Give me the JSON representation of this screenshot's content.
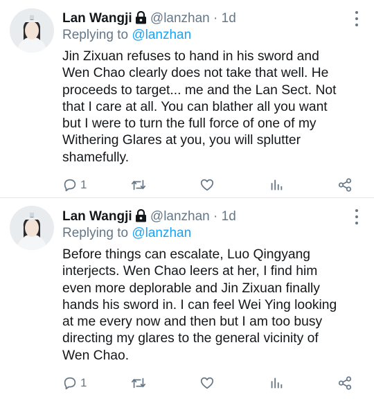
{
  "tweets": [
    {
      "user": {
        "name": "Lan Wangji",
        "handle": "@lanzhan"
      },
      "separator": "·",
      "time": "1d",
      "replying_prefix": "Replying to",
      "replying_to": "@lanzhan",
      "text_lines": [
        "Jin Zixuan refuses to hand in his sword and",
        "Wen Chao clearly does not take that well. He",
        "proceeds to target... me and the Lan Sect. Not",
        "that I care at all. You can blather all you want",
        "but I were to turn the full force of one of my",
        "Withering Glares at you, you will splutter",
        "shamefully."
      ],
      "reply_count": "1"
    },
    {
      "user": {
        "name": "Lan Wangji",
        "handle": "@lanzhan"
      },
      "separator": "·",
      "time": "1d",
      "replying_prefix": "Replying to",
      "replying_to": "@lanzhan",
      "text_lines": [
        "Before things can escalate, Luo Qingyang",
        "interjects. Wen Chao leers at her, I find him",
        "even more deplorable and Jin Zixuan finally",
        "hands his sword in. I can feel Wei Ying looking",
        "at me every now and then but I am too busy",
        "directing my glares to the general vicinity of",
        "Wen Chao."
      ],
      "reply_count": "1"
    }
  ],
  "icons": {
    "lock": "lock-icon",
    "more": "more-vertical-icon",
    "reply": "reply-icon",
    "retweet": "retweet-icon",
    "like": "heart-icon",
    "stats": "analytics-icon",
    "share": "share-icon"
  },
  "colors": {
    "text": "#14171a",
    "secondary": "#657786",
    "link": "#1da1f2",
    "divider": "#e1e8ed"
  }
}
